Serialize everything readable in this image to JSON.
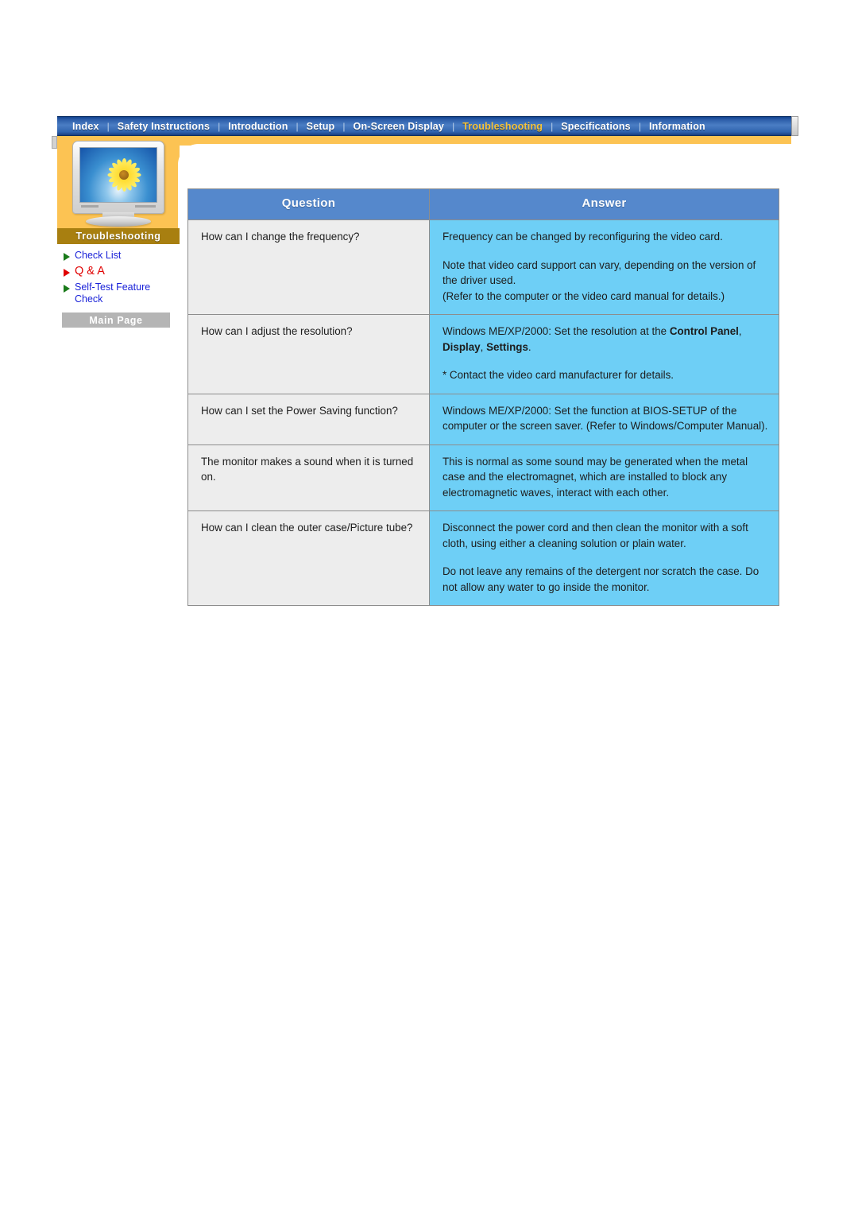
{
  "topnav": {
    "items": [
      {
        "label": "Index",
        "active": false
      },
      {
        "label": "Safety Instructions",
        "active": false
      },
      {
        "label": "Introduction",
        "active": false
      },
      {
        "label": "Setup",
        "active": false
      },
      {
        "label": "On-Screen Display",
        "active": false
      },
      {
        "label": "Troubleshooting",
        "active": true
      },
      {
        "label": "Specifications",
        "active": false
      },
      {
        "label": "Information",
        "active": false
      }
    ],
    "separator": "|",
    "active_color": "#f5c33a",
    "bar_color": "#2b5ca8"
  },
  "sidebar": {
    "section_label": "Troubleshooting",
    "monitor_icon": "monitor-with-sunflower-image",
    "links": [
      {
        "label": "Check List",
        "active": false
      },
      {
        "label": "Q & A",
        "active": true
      },
      {
        "label": "Self-Test Feature Check",
        "active": false
      }
    ],
    "main_page_button": "Main Page",
    "accent_orange": "#fcc353",
    "label_bar_color": "#a87f10",
    "link_color": "#1a22d8",
    "active_link_color": "#e00000"
  },
  "table": {
    "headers": [
      "Question",
      "Answer"
    ],
    "header_bg": "#5588cc",
    "question_bg": "#ededed",
    "answer_bg": "#6ecff6",
    "rows": [
      {
        "question": [
          "How can I change the frequency?"
        ],
        "answer": [
          "Frequency can be changed by reconfiguring the video card.",
          "Note that video card support can vary, depending on the version of the driver used.\n(Refer to the computer or the video card manual for details.)"
        ]
      },
      {
        "question": [
          "How can I adjust the resolution?"
        ],
        "answer_rich": {
          "p1_pre": "Windows ME/XP/2000: Set the resolution at the ",
          "p1_b1": "Control Panel",
          "p1_mid1": ", ",
          "p1_b2": "Display",
          "p1_mid2": ", ",
          "p1_b3": "Settings",
          "p1_post": ".",
          "p2": "* Contact the video card manufacturer for details."
        }
      },
      {
        "question": [
          "How can I set the Power Saving function?"
        ],
        "answer": [
          "Windows ME/XP/2000: Set the function at BIOS-SETUP of the computer or the screen saver. (Refer to Windows/Computer Manual)."
        ]
      },
      {
        "question": [
          "The monitor makes a sound when it is turned on."
        ],
        "answer": [
          "This is normal as some sound may be generated when the metal case and the electromagnet, which are installed to block any electromagnetic waves, interact with each other."
        ]
      },
      {
        "question": [
          "How can I clean the outer case/Picture tube?"
        ],
        "answer": [
          "Disconnect the power cord and then clean the monitor with a soft cloth, using either a cleaning solution or plain water.",
          "Do not leave any remains of the detergent nor scratch the case. Do not allow any water to go inside the monitor."
        ]
      }
    ]
  }
}
